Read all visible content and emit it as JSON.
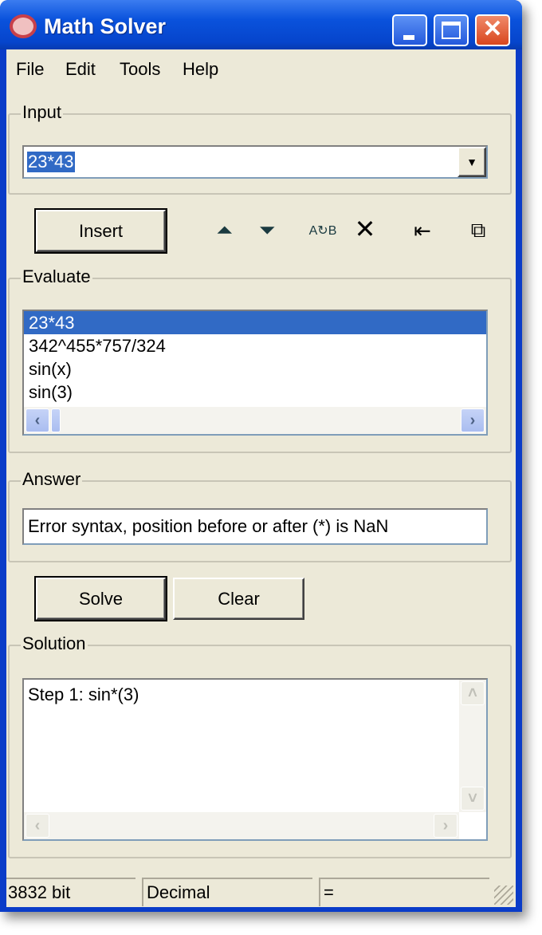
{
  "window": {
    "title": "Math Solver"
  },
  "menu": [
    "File",
    "Edit",
    "Tools",
    "Help"
  ],
  "input": {
    "legend": "Input",
    "value": "23*43"
  },
  "toolbar": {
    "insert_label": "Insert"
  },
  "evaluate": {
    "legend": "Evaluate",
    "items": [
      "23*43",
      "342^455*757/324",
      "sin(x)",
      "sin(3)"
    ],
    "selected_index": 0
  },
  "answer": {
    "legend": "Answer",
    "value": "Error syntax, position before or after (*) is NaN"
  },
  "actions": {
    "solve_label": "Solve",
    "clear_label": "Clear"
  },
  "solution": {
    "legend": "Solution",
    "text": "Step 1: sin*(3)"
  },
  "status": {
    "bits": "3832 bit",
    "mode": "Decimal",
    "result": "="
  }
}
